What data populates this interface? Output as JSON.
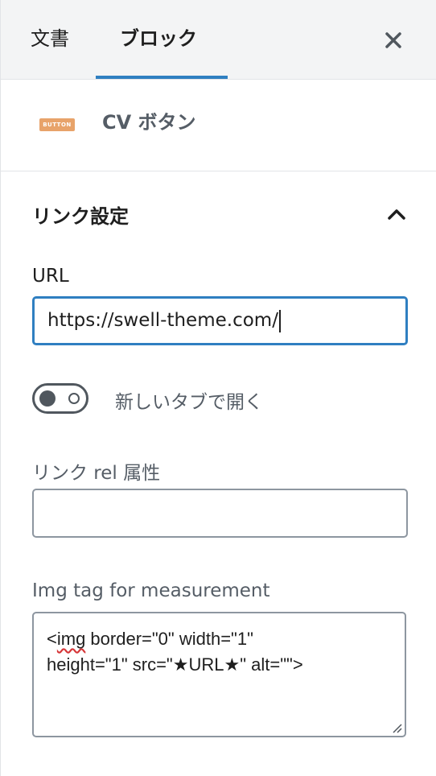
{
  "tabs": {
    "document_label": "文書",
    "block_label": "ブロック",
    "active": "block"
  },
  "block": {
    "icon_text": "BUTTON",
    "title": "CV ボタン"
  },
  "link_settings": {
    "title": "リンク設定",
    "expanded": true,
    "url_label": "URL",
    "url_value": "https://swell-theme.com/",
    "new_tab_label": "新しいタブで開く",
    "new_tab_enabled": false,
    "rel_label": "リンク rel 属性",
    "rel_value": "",
    "img_tag_label": "Img tag for measurement",
    "img_tag_value_prefix": "<",
    "img_tag_value_misspelled": "img",
    "img_tag_value_line1_rest": " border=\"0\" width=\"1\"",
    "img_tag_value_line2": "height=\"1\" src=\"★URL★\" alt=\"\">"
  },
  "colors": {
    "accent": "#2f7fc1",
    "icon_bg": "#e8a36a",
    "muted_text": "#555d66",
    "toggle": "#50575e"
  },
  "icons": {
    "close": "close-icon",
    "chevron": "chevron-up-icon",
    "block": "button-block-icon"
  }
}
